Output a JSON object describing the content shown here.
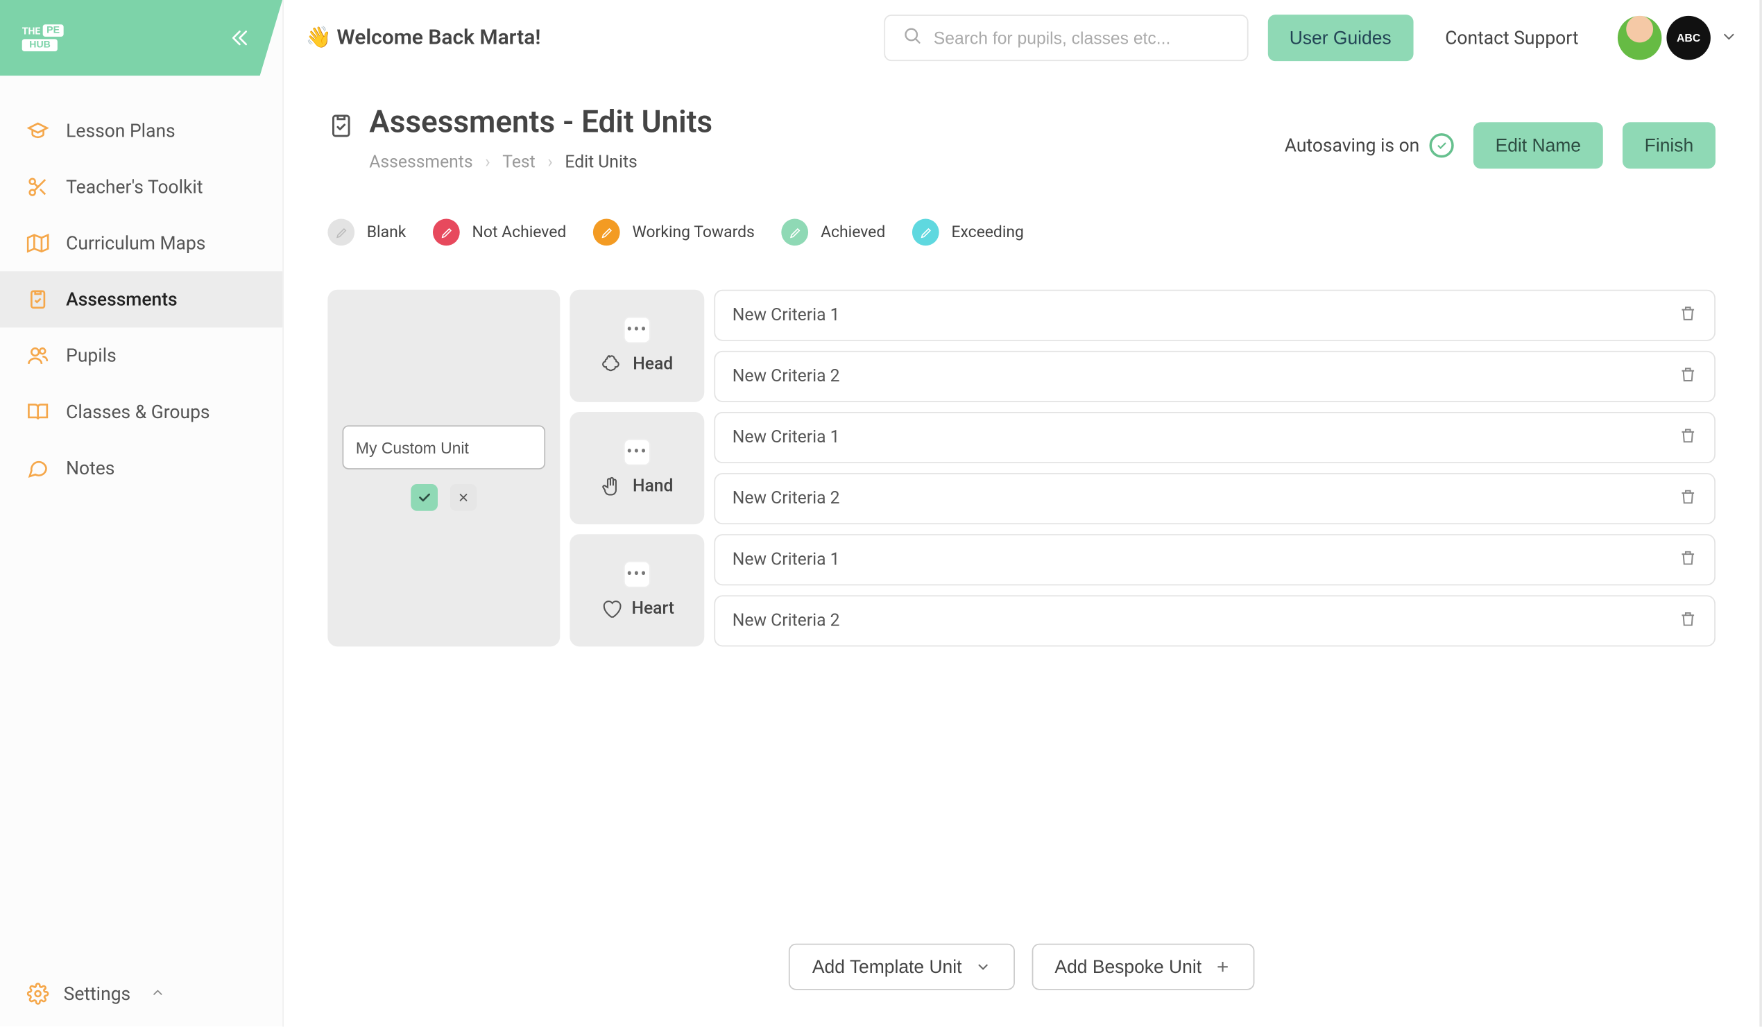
{
  "brand": {
    "p1": "THE",
    "p2": "PE",
    "p3": "HUB"
  },
  "welcome": "👋 Welcome Back Marta!",
  "search": {
    "placeholder": "Search for pupils, classes etc..."
  },
  "topbar": {
    "user_guides": "User Guides",
    "contact_support": "Contact Support",
    "school_badge": "ABC"
  },
  "sidebar": {
    "items": [
      {
        "label": "Lesson Plans"
      },
      {
        "label": "Teacher's Toolkit"
      },
      {
        "label": "Curriculum Maps"
      },
      {
        "label": "Assessments"
      },
      {
        "label": "Pupils"
      },
      {
        "label": "Classes & Groups"
      },
      {
        "label": "Notes"
      }
    ],
    "settings": "Settings"
  },
  "page": {
    "title": "Assessments - Edit Units",
    "breadcrumb": {
      "a": "Assessments",
      "b": "Test",
      "c": "Edit Units"
    },
    "autosave": "Autosaving is on",
    "edit_name": "Edit Name",
    "finish": "Finish"
  },
  "legend": [
    {
      "label": "Blank"
    },
    {
      "label": "Not Achieved"
    },
    {
      "label": "Working Towards"
    },
    {
      "label": "Achieved"
    },
    {
      "label": "Exceeding"
    }
  ],
  "unit": {
    "name_value": "My Custom Unit"
  },
  "sections": [
    {
      "name": "Head",
      "criteria": [
        "New Criteria 1",
        "New Criteria 2"
      ]
    },
    {
      "name": "Hand",
      "criteria": [
        "New Criteria 1",
        "New Criteria 2"
      ]
    },
    {
      "name": "Heart",
      "criteria": [
        "New Criteria 1",
        "New Criteria 2"
      ]
    }
  ],
  "bottom": {
    "add_template": "Add Template Unit",
    "add_bespoke": "Add Bespoke Unit"
  }
}
